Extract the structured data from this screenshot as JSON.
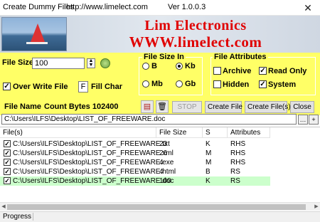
{
  "window": {
    "title": "Create Dummy Files",
    "url": "http://www.limelect.com",
    "version": "Ver 1.0.0.3",
    "close_glyph": "✕"
  },
  "banner": {
    "company": "Lim Electronics",
    "website": "WWW.limelect.com"
  },
  "form": {
    "file_size_label": "File Size",
    "file_size_value": "100",
    "overwrite_label": "Over Write File",
    "overwrite_checked": true,
    "fill_char_value": "F",
    "fill_char_label": "Fill Char",
    "file_name_label": "File Name",
    "count_bytes": "Count Bytes 102400",
    "path_value": "C:\\Users\\ILFS\\Desktop\\LIST_OF_FREEWARE.doc"
  },
  "size_in": {
    "title": "File Size In",
    "options": [
      {
        "label": "B",
        "selected": false
      },
      {
        "label": "Kb",
        "selected": true
      },
      {
        "label": "Mb",
        "selected": false
      },
      {
        "label": "Gb",
        "selected": false
      }
    ]
  },
  "attributes": {
    "title": "File Attributes",
    "items": [
      {
        "label": "Archive",
        "checked": false
      },
      {
        "label": "Read Only",
        "checked": true
      },
      {
        "label": "Hidden",
        "checked": false
      },
      {
        "label": "System",
        "checked": true
      }
    ]
  },
  "buttons": {
    "stop": "STOP",
    "create_file": "Create File",
    "create_files": "Create File(s)",
    "close": "Close"
  },
  "table": {
    "headers": [
      "File(s)",
      "File Size",
      "S",
      "Attributes"
    ],
    "rows": [
      {
        "file": "C:\\Users\\ILFS\\Desktop\\LIST_OF_FREEWARE.txt",
        "size": "23",
        "s": "K",
        "attr": "RHS",
        "checked": true,
        "selected": false
      },
      {
        "file": "C:\\Users\\ILFS\\Desktop\\LIST_OF_FREEWARE.xml",
        "size": "26",
        "s": "M",
        "attr": "RHS",
        "checked": true,
        "selected": false
      },
      {
        "file": "C:\\Users\\ILFS\\Desktop\\LIST_OF_FREEWARE.exe",
        "size": "4",
        "s": "M",
        "attr": "RHS",
        "checked": true,
        "selected": false
      },
      {
        "file": "C:\\Users\\ILFS\\Desktop\\LIST_OF_FREEWARE.html",
        "size": "4",
        "s": "B",
        "attr": "RS",
        "checked": true,
        "selected": false
      },
      {
        "file": "C:\\Users\\ILFS\\Desktop\\LIST_OF_FREEWARE.doc",
        "size": "100",
        "s": "K",
        "attr": "RS",
        "checked": true,
        "selected": true
      }
    ]
  },
  "status": {
    "progress_label": "Progress"
  },
  "colors": {
    "panel": "#ffff66",
    "brand_red": "#e00000",
    "selected_row": "#ccffcc"
  }
}
